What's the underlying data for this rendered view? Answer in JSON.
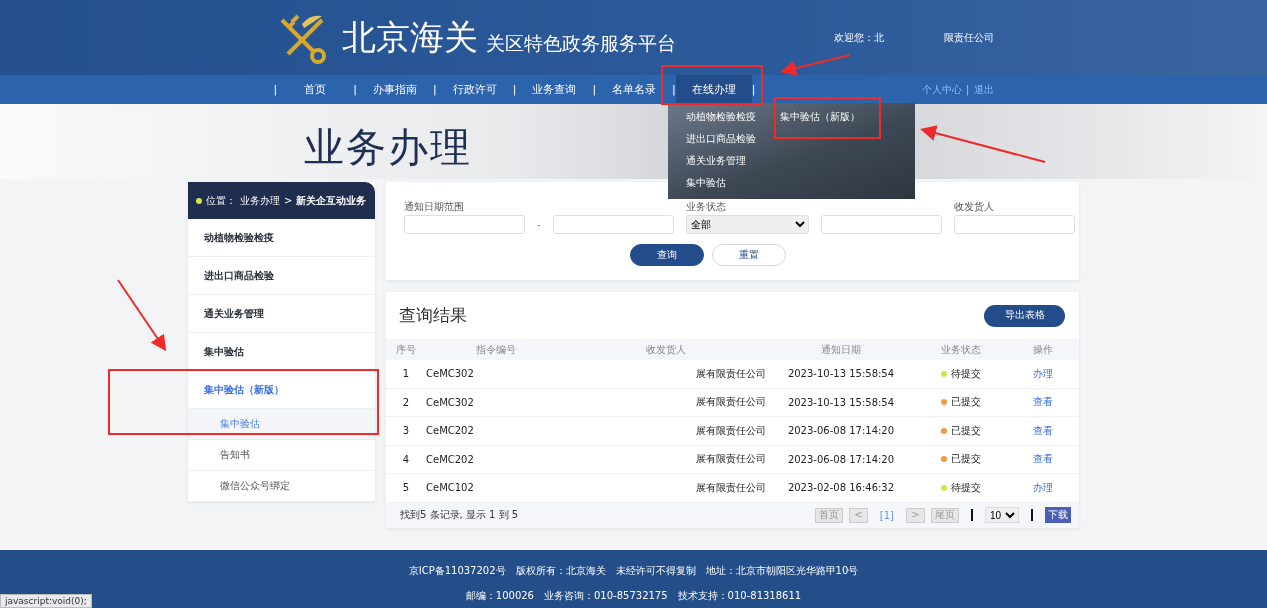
{
  "header": {
    "site_name": "北京海关",
    "subtitle": "关区特色政务服务平台",
    "welcome": "欢迎您：北",
    "company": "限责任公司"
  },
  "nav": {
    "items": [
      {
        "label": "首页",
        "selected": false
      },
      {
        "label": "办事指南",
        "selected": false
      },
      {
        "label": "行政许可",
        "selected": false
      },
      {
        "label": "业务查询",
        "selected": false
      },
      {
        "label": "名单名录",
        "selected": false
      },
      {
        "label": "在线办理",
        "selected": true
      }
    ],
    "separator": "|",
    "user_links": [
      "个人中心",
      "退出"
    ],
    "user_link_separator": "|"
  },
  "dropdown": {
    "columns": [
      [
        "动植物检验检疫",
        "进出口商品检验",
        "通关业务管理",
        "集中验估"
      ],
      [
        "集中验估（新版）"
      ]
    ]
  },
  "hero": {
    "title": "业务办理"
  },
  "sidebar": {
    "location_label": "位置：",
    "breadcrumb": "业务办理",
    "breadcrumb_separator": ">",
    "current": "新关企互动业务",
    "items": [
      {
        "label": "动植物检验检疫",
        "selected": false
      },
      {
        "label": "进出口商品检验",
        "selected": false
      },
      {
        "label": "通关业务管理",
        "selected": false
      },
      {
        "label": "集中验估",
        "selected": false
      },
      {
        "label": "集中验估（新版）",
        "selected": true,
        "children": [
          {
            "label": "集中验估",
            "selected": true
          },
          {
            "label": "告知书",
            "selected": false
          },
          {
            "label": "微信公众号绑定",
            "selected": false
          }
        ]
      }
    ]
  },
  "filters": {
    "date_label": "通知日期范围",
    "date_sep": "-",
    "status_label": "业务状态",
    "status_value": "全部",
    "consignee_label": "收发货人",
    "search_button": "查询",
    "reset_button": "重置"
  },
  "results": {
    "title": "查询结果",
    "export_button": "导出表格",
    "columns": [
      "序号",
      "指令编号",
      "收发货人",
      "通知日期",
      "业务状态",
      "操作"
    ],
    "rows": [
      {
        "no": "1",
        "code": "CeMC302",
        "consignee": "展有限责任公司",
        "date": "2023-10-13 15:58:54",
        "status": "待提交",
        "color": "#cde64a",
        "action": "办理"
      },
      {
        "no": "2",
        "code": "CeMC302",
        "consignee": "展有限责任公司",
        "date": "2023-10-13 15:58:54",
        "status": "已提交",
        "color": "#f29a3c",
        "action": "查看"
      },
      {
        "no": "3",
        "code": "CeMC202",
        "consignee": "展有限责任公司",
        "date": "2023-06-08 17:14:20",
        "status": "已提交",
        "color": "#f29a3c",
        "action": "查看"
      },
      {
        "no": "4",
        "code": "CeMC202",
        "consignee": "展有限责任公司",
        "date": "2023-06-08 17:14:20",
        "status": "已提交",
        "color": "#f29a3c",
        "action": "查看"
      },
      {
        "no": "5",
        "code": "CeMC102",
        "consignee": "展有限责任公司",
        "date": "2023-02-08 16:46:32",
        "status": "待提交",
        "color": "#cde64a",
        "action": "办理"
      }
    ],
    "summary": "找到5 条记录, 显示 1 到 5",
    "pager": {
      "first": "首页",
      "prev": "<",
      "current": "[1]",
      "next": ">",
      "last": "尾页",
      "page_size": "10",
      "download": "下载"
    }
  },
  "footer": {
    "lines": [
      "京ICP备11037202号　版权所有：北京海关　未经许可不得复制　地址：北京市朝阳区光华路甲10号",
      "邮编：100026　业务咨询：010-85732175　技术支持：010-81318611"
    ]
  },
  "browser_status": "javascript:void(0);"
}
